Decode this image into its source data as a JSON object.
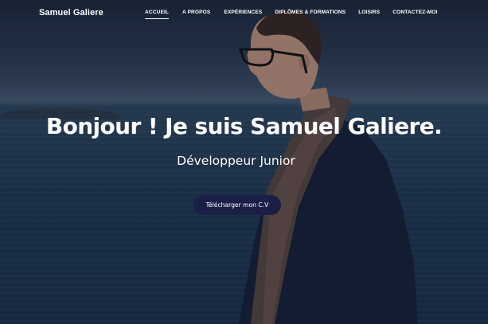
{
  "nav": {
    "brand": "Samuel Galiere",
    "links": [
      {
        "label": "ACCUEIL",
        "active": true
      },
      {
        "label": "A PROPOS",
        "active": false
      },
      {
        "label": "EXPÉRIENCES",
        "active": false
      },
      {
        "label": "DIPLÔMES & FORMATIONS",
        "active": false
      },
      {
        "label": "LOISIRS",
        "active": false
      },
      {
        "label": "CONTACTEZ-MOI",
        "active": false
      }
    ]
  },
  "hero": {
    "title": "Bonjour ! Je suis Samuel Galiere.",
    "subtitle": "Développeur Junior",
    "cv_button": "Télécharger mon C.V",
    "background": "photo of a man in profile wearing glasses and a scarf in front of the sea"
  },
  "colors": {
    "button_bg": "#1b1f45",
    "text": "#ffffff",
    "sea": "#27425d"
  }
}
